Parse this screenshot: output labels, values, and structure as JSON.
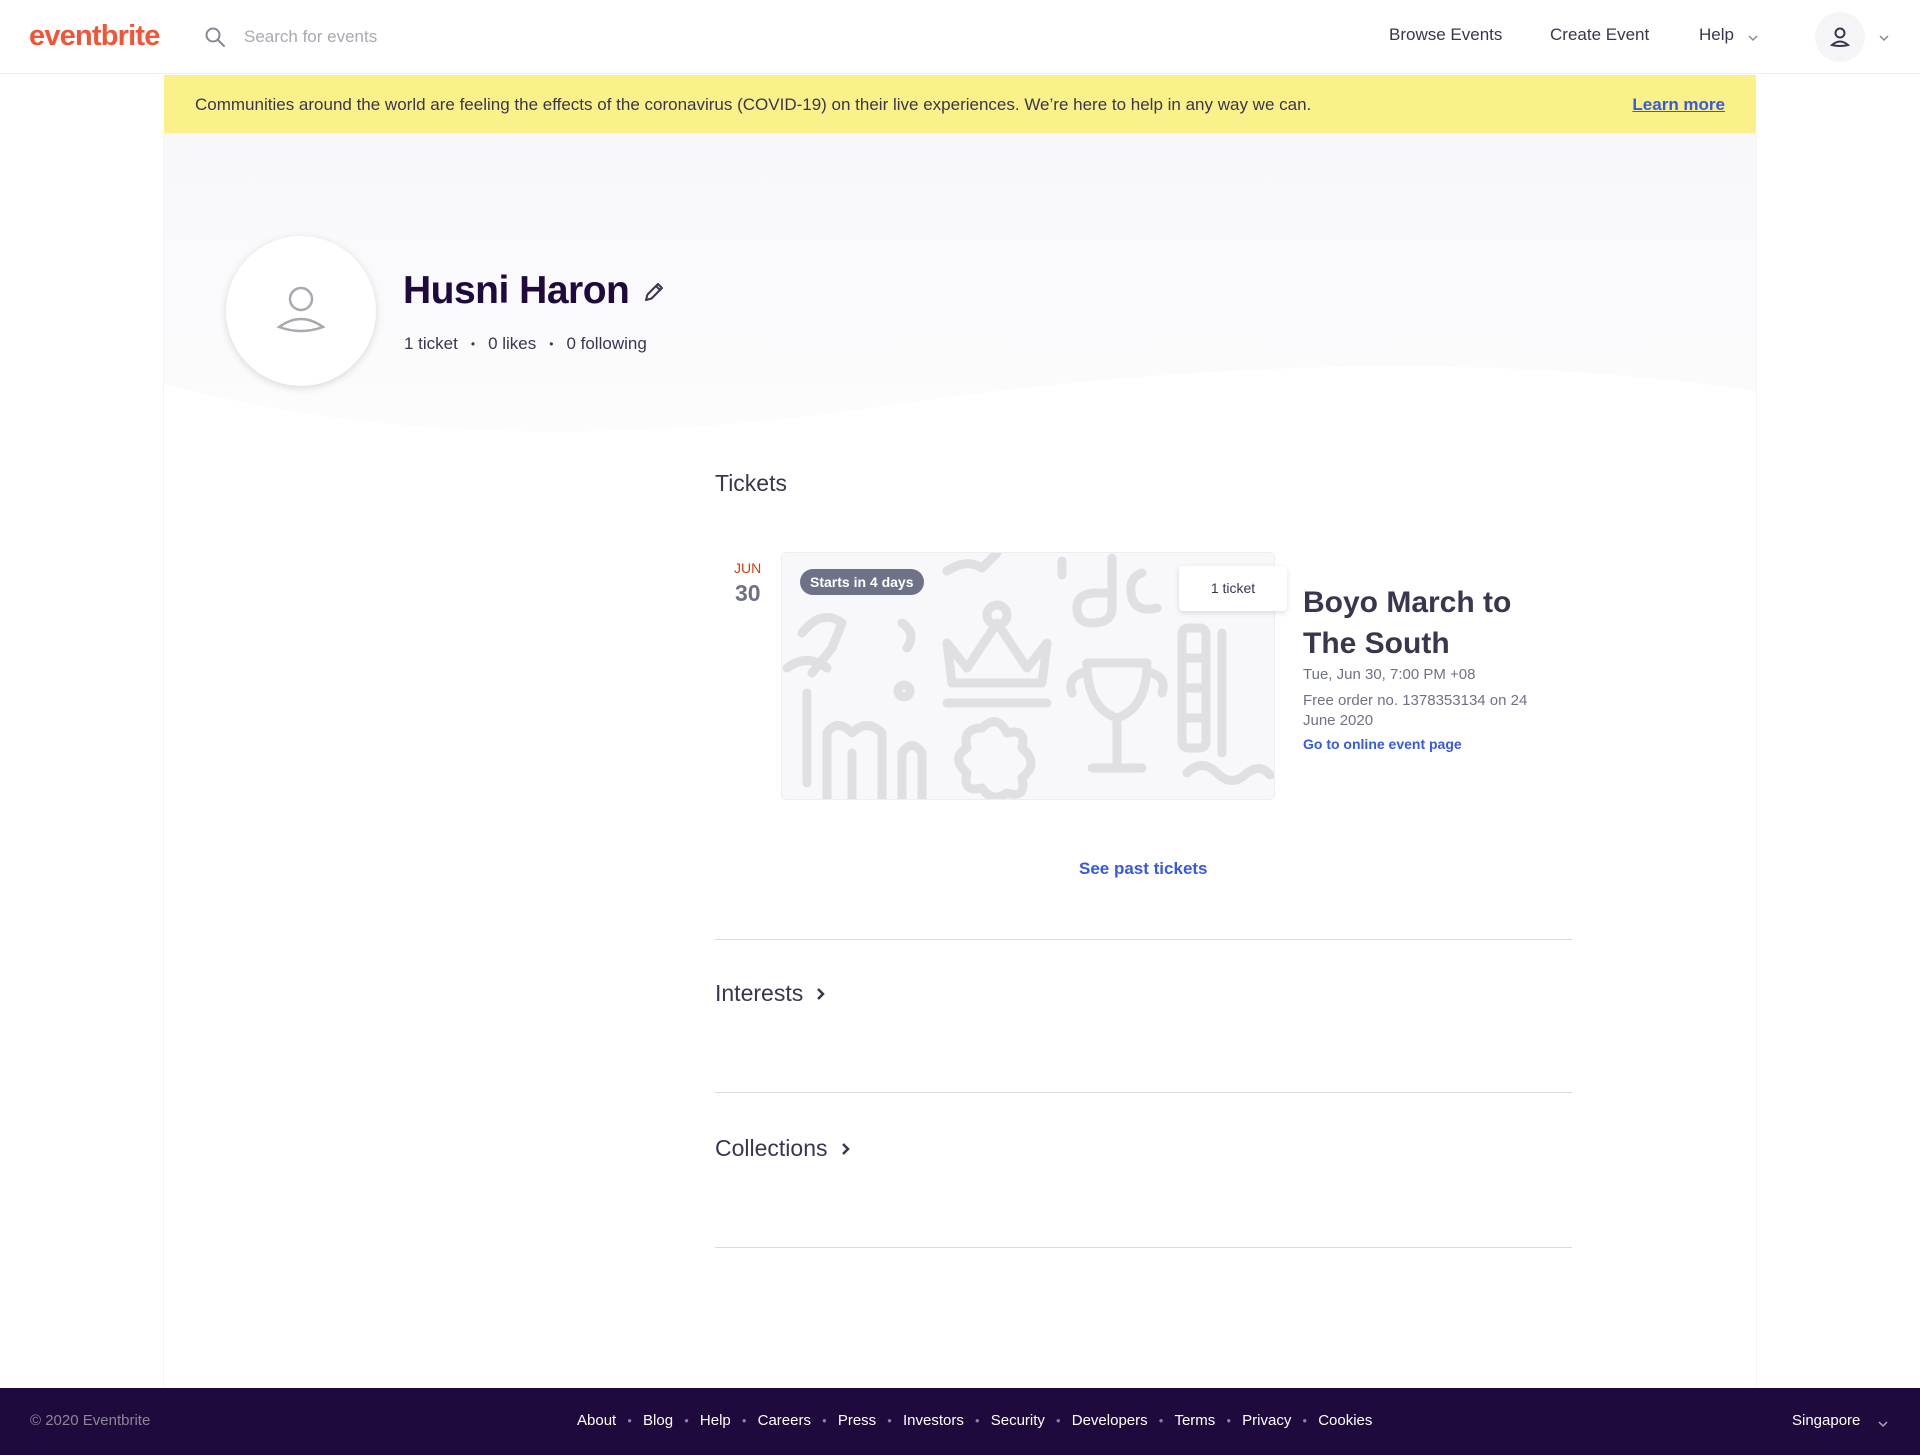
{
  "header": {
    "logo": "eventbrite",
    "search_placeholder": "Search for events",
    "nav": {
      "browse": "Browse Events",
      "create": "Create Event",
      "help": "Help"
    }
  },
  "banner": {
    "text": "Communities around the world are feeling the effects of the coronavirus (COVID-19) on their live experiences. We’re here to help in any way we can.",
    "link": "Learn more"
  },
  "profile": {
    "name": "Husni Haron",
    "stats": {
      "tickets": "1 ticket",
      "likes": "0 likes",
      "following": "0 following"
    }
  },
  "tickets_section": {
    "heading": "Tickets",
    "event": {
      "month": "JUN",
      "day": "30",
      "badge": "Starts in 4 days",
      "ticket_count": "1 ticket",
      "title": "Boyo March to The South",
      "datetime": "Tue, Jun 30, 7:00 PM +08",
      "order": "Free order no. 1378353134 on 24 June 2020",
      "link": "Go to online event page"
    },
    "past_link": "See past tickets"
  },
  "interests": {
    "heading": "Interests"
  },
  "collections": {
    "heading": "Collections"
  },
  "footer": {
    "copyright": "© 2020 Eventbrite",
    "links": [
      "About",
      "Blog",
      "Help",
      "Careers",
      "Press",
      "Investors",
      "Security",
      "Developers",
      "Terms",
      "Privacy",
      "Cookies"
    ],
    "region": "Singapore"
  },
  "colors": {
    "brand": "#f05537",
    "banner": "#fbf18a",
    "link": "#3659e3",
    "footer": "#1e0a3c"
  },
  "icons": [
    "search-icon",
    "chevron-down-icon",
    "user-icon",
    "pencil-icon",
    "chevron-right-icon"
  ]
}
